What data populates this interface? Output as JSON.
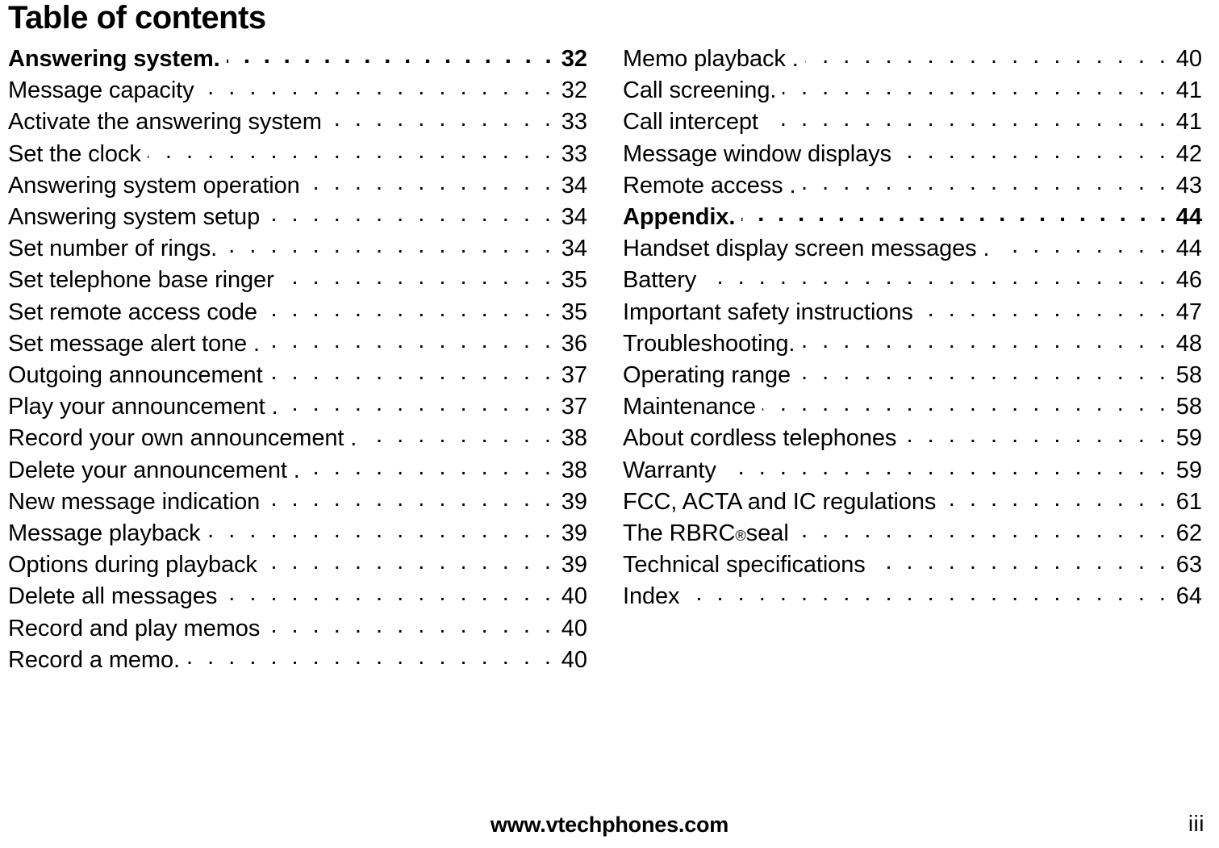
{
  "page": {
    "title": "Table of contents",
    "footer_center": "www.vtechphones.com",
    "footer_page_number": "iii"
  },
  "columns": [
    {
      "entries": [
        {
          "label": "Answering system.",
          "page": "32",
          "bold": true
        },
        {
          "label": "Message capacity",
          "page": "32",
          "bold": false
        },
        {
          "label": "Activate the answering system",
          "page": "33",
          "bold": false
        },
        {
          "label": "Set the clock",
          "page": "33",
          "bold": false
        },
        {
          "label": "Answering system operation",
          "page": "34",
          "bold": false
        },
        {
          "label": "Answering system setup",
          "page": "34",
          "bold": false
        },
        {
          "label": "Set number of rings.",
          "page": "34",
          "bold": false
        },
        {
          "label": "Set telephone base ringer",
          "page": "35",
          "bold": false
        },
        {
          "label": "Set remote access code",
          "page": "35",
          "bold": false
        },
        {
          "label": "Set message alert tone .",
          "page": "36",
          "bold": false
        },
        {
          "label": "Outgoing announcement",
          "page": "37",
          "bold": false
        },
        {
          "label": "Play your announcement .",
          "page": "37",
          "bold": false
        },
        {
          "label": "Record your own announcement .",
          "page": "38",
          "bold": false
        },
        {
          "label": "Delete your announcement .",
          "page": "38",
          "bold": false
        },
        {
          "label": "New message indication",
          "page": "39",
          "bold": false
        },
        {
          "label": "Message playback",
          "page": "39",
          "bold": false
        },
        {
          "label": "Options during playback",
          "page": "39",
          "bold": false
        },
        {
          "label": "Delete all messages",
          "page": "40",
          "bold": false
        },
        {
          "label": "Record and play memos",
          "page": "40",
          "bold": false
        },
        {
          "label": "Record a memo.",
          "page": "40",
          "bold": false
        }
      ]
    },
    {
      "entries": [
        {
          "label": "Memo playback .",
          "page": "40",
          "bold": false
        },
        {
          "label": "Call screening.",
          "page": "41",
          "bold": false
        },
        {
          "label": "Call intercept",
          "page": "41",
          "bold": false
        },
        {
          "label": "Message window displays",
          "page": "42",
          "bold": false
        },
        {
          "label": "Remote access .",
          "page": "43",
          "bold": false
        },
        {
          "label": "Appendix.",
          "page": "44",
          "bold": true
        },
        {
          "label": "Handset display screen messages .",
          "page": "44",
          "bold": false
        },
        {
          "label": "Battery",
          "page": "46",
          "bold": false
        },
        {
          "label": "Important safety instructions",
          "page": "47",
          "bold": false
        },
        {
          "label": "Troubleshooting.",
          "page": "48",
          "bold": false
        },
        {
          "label": "Operating range",
          "page": "58",
          "bold": false
        },
        {
          "label": "Maintenance",
          "page": "58",
          "bold": false
        },
        {
          "label": "About cordless telephones",
          "page": "59",
          "bold": false
        },
        {
          "label": "Warranty",
          "page": "59",
          "bold": false
        },
        {
          "label": "FCC, ACTA and IC regulations",
          "page": "61",
          "bold": false
        },
        {
          "label": "The RBRC® seal",
          "page": "62",
          "bold": false,
          "sup": "®",
          "label_pre": "The RBRC",
          "label_post": " seal"
        },
        {
          "label": "Technical specifications",
          "page": "63",
          "bold": false
        },
        {
          "label": "Index",
          "page": "64",
          "bold": false
        }
      ]
    }
  ]
}
